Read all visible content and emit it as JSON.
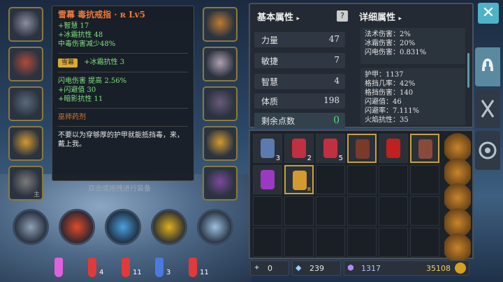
{
  "tooltip": {
    "title": "雪幕 毒抗戒指 · ʀ Lv5",
    "base_stats": [
      "+智慧 17",
      "+冰霜抗性 48",
      "中毒伤害减少48%"
    ],
    "set_tag": "雪幕",
    "set_bonus": "+冰霜抗性 3",
    "random_stats": [
      "闪电伤害 提高 2.56%",
      "+闪避值 30",
      "+暗影抗性 11"
    ],
    "crafter": "巫师药剂",
    "description": "不要以为穿够厚的护甲就能抵挡毒，来，戴上我。",
    "hint": "双击或拖拽进行装备"
  },
  "equipment": {
    "left": [
      {
        "name": "helmet-slot",
        "color": "#8c8ca0"
      },
      {
        "name": "chest-slot",
        "color": "#b04a3a"
      },
      {
        "name": "armor-slot",
        "color": "#5a6a7a"
      },
      {
        "name": "ring-slot",
        "color": "#d49a30"
      },
      {
        "name": "weapon-slot",
        "color": "#7a7a7a",
        "label": "主"
      }
    ],
    "right": [
      {
        "name": "amulet-slot",
        "color": "#c07a30"
      },
      {
        "name": "gloves-slot",
        "color": "#b0a0b0"
      },
      {
        "name": "boots-slot",
        "color": "#6a5a7a"
      },
      {
        "name": "ring2-slot",
        "color": "#d49a30"
      },
      {
        "name": "offhand-slot",
        "color": "#7a4a9a"
      }
    ]
  },
  "skills": [
    "#8ea0b5",
    "#e04a2a",
    "#4aa0e0",
    "#e0b020",
    "#9ac0e0"
  ],
  "potions": [
    {
      "color": "#e060e0",
      "count": ""
    },
    {
      "color": "#e03a3a",
      "count": "4"
    },
    {
      "color": "#e03a3a",
      "count": "11"
    },
    {
      "color": "#4a7ae0",
      "count": "3"
    },
    {
      "color": "#e03a3a",
      "count": "11"
    }
  ],
  "stats_panel": {
    "basic_header": "基本属性",
    "detail_header": "详细属性",
    "stats": [
      {
        "label": "力量",
        "value": "47"
      },
      {
        "label": "敏捷",
        "value": "7"
      },
      {
        "label": "智慧",
        "value": "4"
      },
      {
        "label": "体质",
        "value": "198"
      }
    ],
    "remaining_label": "剩余点数",
    "remaining_value": "0",
    "details_top": [
      "法术伤害：2%",
      "冰霜伤害：20%",
      "闪电伤害：0.831%"
    ],
    "details_bottom": [
      "护甲：1137",
      "格挡几率：42%",
      "格挡伤害：140",
      "闪避值：46",
      "闪避率：7.111%",
      "火焰抗性：35"
    ]
  },
  "inventory": {
    "items": [
      {
        "color": "#5a7ab0",
        "count": "3",
        "gold": false
      },
      {
        "color": "#c03040",
        "count": "2",
        "gold": false
      },
      {
        "color": "#c03040",
        "count": "5",
        "gold": false
      },
      {
        "color": "#7a3a2a",
        "count": "",
        "gold": true
      },
      {
        "color": "#c02020",
        "count": "",
        "gold": false
      },
      {
        "color": "#8a4a3a",
        "count": "",
        "gold": true
      },
      {
        "color": "#9a3ac0",
        "count": "",
        "gold": false
      },
      {
        "color": "#d49a30",
        "count": "",
        "gold": true,
        "r": "ʀ"
      }
    ]
  },
  "currency": {
    "skill_points": "0",
    "gems": "239",
    "crystals": "1317",
    "gold": "35108"
  },
  "close_label": "✕"
}
